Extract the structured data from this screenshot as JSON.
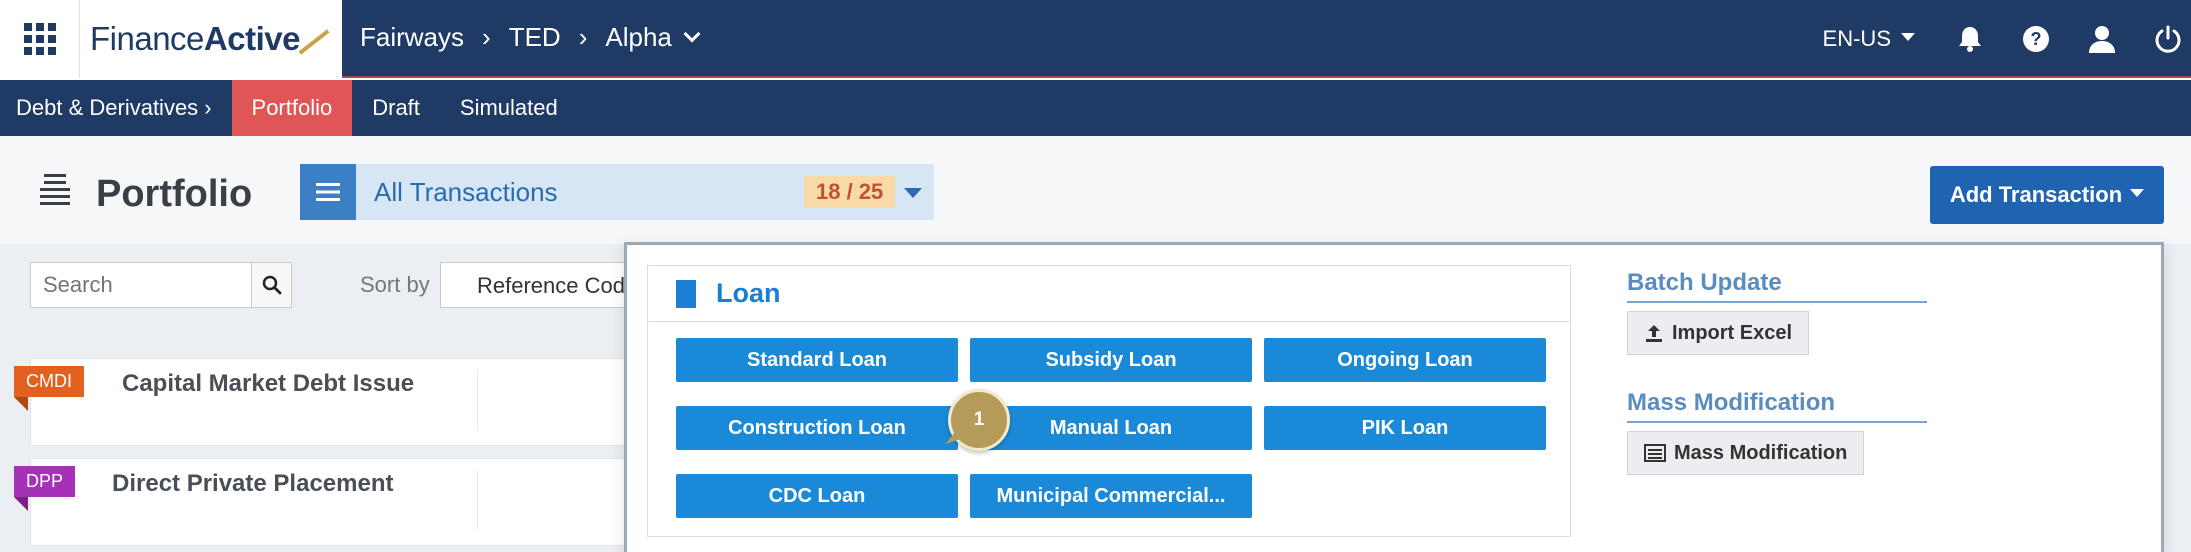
{
  "header": {
    "logo_part1": "Finance",
    "logo_part2": "Active",
    "breadcrumb": [
      "Fairways",
      "TED",
      "Alpha"
    ],
    "language": "EN-US",
    "icons": [
      "bell-icon",
      "help-icon",
      "user-icon",
      "power-icon"
    ]
  },
  "subnav": {
    "items": [
      "Debt & Derivatives",
      "Portfolio",
      "Draft",
      "Simulated"
    ],
    "active": "Portfolio"
  },
  "page": {
    "title": "Portfolio",
    "view_label": "All Transactions",
    "view_count": "18 / 25",
    "add_button": "Add Transaction"
  },
  "filters": {
    "search_placeholder": "Search",
    "sort_label": "Sort by",
    "sort_value": "Reference Code"
  },
  "cards": [
    {
      "tag": "CMDI",
      "title": "Capital Market Debt Issue",
      "color": "#e2611e",
      "fold": "#b04612"
    },
    {
      "tag": "DPP",
      "title": "Direct Private Placement",
      "color": "#a431b8",
      "fold": "#7a2189"
    }
  ],
  "dropdown": {
    "section_title": "Loan",
    "buttons": [
      "Standard Loan",
      "Subsidy Loan",
      "Ongoing Loan",
      "Construction Loan",
      "Manual Loan",
      "PIK Loan",
      "CDC Loan",
      "Municipal Commercial..."
    ],
    "step_marker": "1",
    "batch_update": {
      "title": "Batch Update",
      "button": "Import Excel"
    },
    "mass_modification": {
      "title": "Mass Modification",
      "button": "Mass Modification"
    }
  },
  "colors": {
    "nav_bg": "#1f3a64",
    "active_tab": "#e05556",
    "accent_blue": "#1a8ad8",
    "primary_button": "#1f64b0"
  }
}
